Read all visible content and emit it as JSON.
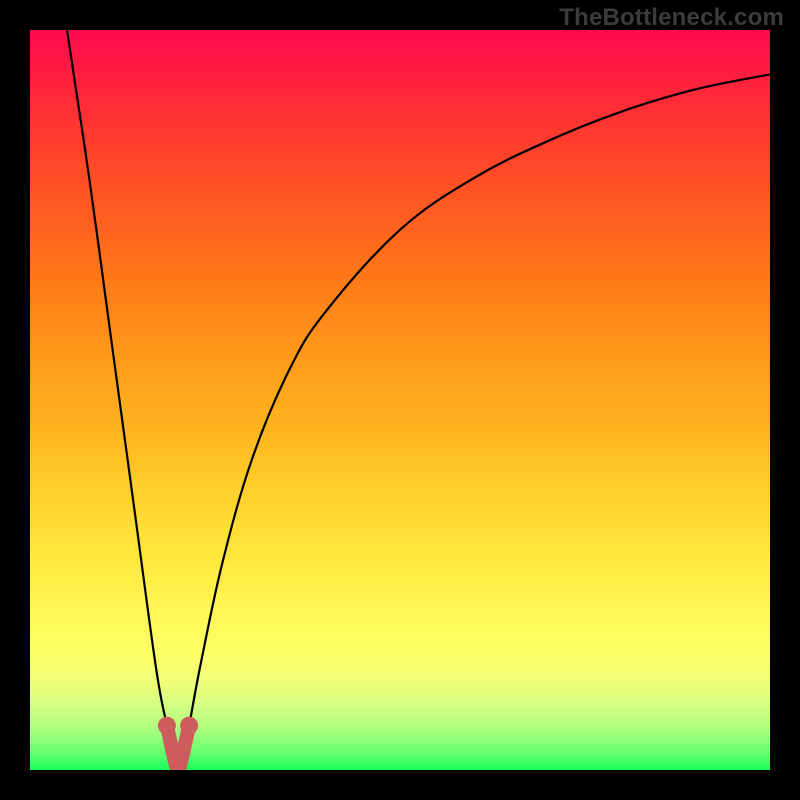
{
  "watermark": "TheBottleneck.com",
  "colors": {
    "background": "#000000",
    "curve": "#000000",
    "tip_accent": "#cd5c5c"
  },
  "chart_data": {
    "type": "line",
    "title": "",
    "xlabel": "",
    "ylabel": "",
    "xlim": [
      0,
      100
    ],
    "ylim": [
      0,
      100
    ],
    "grid": false,
    "optimum_x": 20,
    "series": [
      {
        "name": "bottleneck-curve",
        "x": [
          5,
          8,
          11,
          14,
          17,
          18.5,
          19.5,
          20,
          20.5,
          21.5,
          23,
          26,
          30,
          35,
          40,
          50,
          60,
          70,
          80,
          90,
          100
        ],
        "y": [
          100,
          80,
          58,
          36,
          14,
          6,
          1.5,
          0,
          1.5,
          6,
          14,
          28,
          42,
          54,
          62,
          73,
          80,
          85,
          89,
          92,
          94
        ]
      }
    ],
    "annotations": [
      {
        "type": "highlight",
        "x_range": [
          18.5,
          21.5
        ],
        "label": "optimal-region"
      }
    ]
  }
}
